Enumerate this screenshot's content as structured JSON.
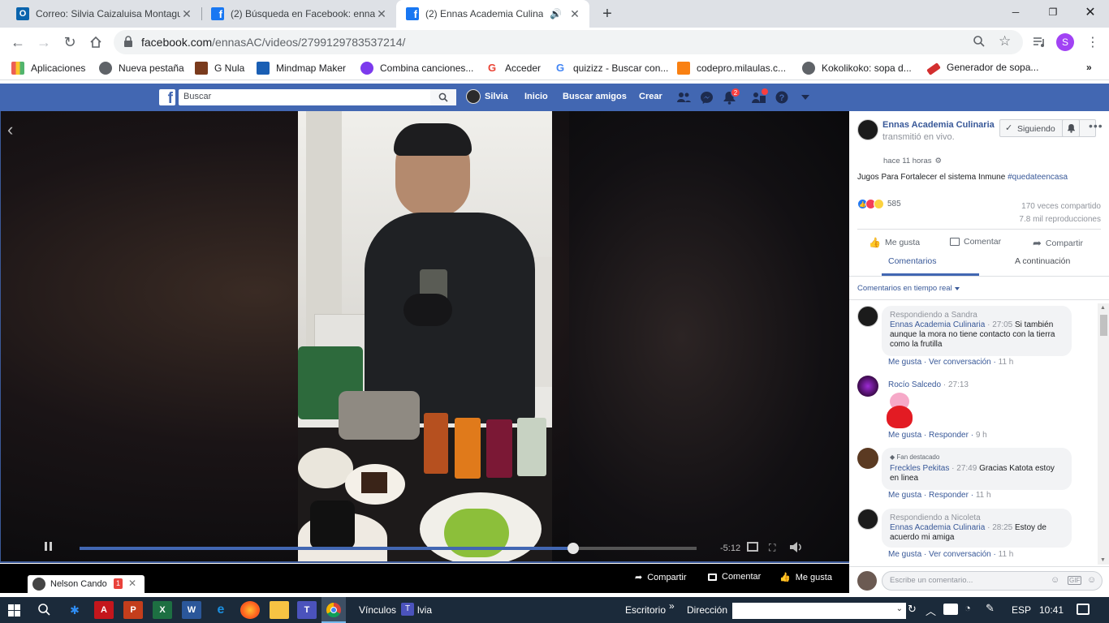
{
  "browser": {
    "tabs": [
      {
        "title": "Correo: Silvia Caizaluisa Montagu"
      },
      {
        "title": "(2) Búsqueda en Facebook: enna"
      },
      {
        "title": "(2) Ennas Academia Culinari"
      }
    ],
    "url_host": "facebook.com",
    "url_path": "/ennasAC/videos/2799129783537214/",
    "profile_initial": "S",
    "bookmarks": [
      "Aplicaciones",
      "Nueva pestaña",
      "G Nula",
      "Mindmap Maker",
      "Combina canciones...",
      "Acceder",
      "quizizz - Buscar con...",
      "codepro.milaulas.c...",
      "Kokolikoko: sopa d...",
      "Generador de sopa..."
    ]
  },
  "fb": {
    "search_placeholder": "Buscar",
    "user": "Silvia",
    "nav": [
      "Inicio",
      "Buscar amigos",
      "Crear"
    ],
    "notif_count": "2"
  },
  "video": {
    "time_remaining": "-5:12",
    "progress": 0.8,
    "actions": [
      "Compartir",
      "Comentar",
      "Me gusta"
    ]
  },
  "chat": {
    "name": "Nelson Cando",
    "badge": "1"
  },
  "post": {
    "page_name": "Ennas Academia Culinaria",
    "action": "transmitió en vivo.",
    "time": "hace 11 horas",
    "follow_label": "Siguiendo",
    "description": "Jugos Para Fortalecer el sistema Inmune",
    "hashtag": "#quedateencasa",
    "reaction_count": "585",
    "shares": "170 veces compartido",
    "views": "7.8 mil reproducciones",
    "actions": [
      "Me gusta",
      "Comentar",
      "Compartir"
    ],
    "tabs": [
      "Comentarios",
      "A continuación"
    ],
    "filter": "Comentarios en tiempo real",
    "comment_placeholder": "Escribe un comentario..."
  },
  "comments": [
    {
      "reply_to": "Respondiendo a Sandra",
      "author": "Ennas Academia Culinaria",
      "ts": "27:05",
      "text": "Si también aunque la mora no tiene contacto con la tierra como la frutilla",
      "links": [
        "Me gusta",
        "Ver conversación",
        "11 h"
      ]
    },
    {
      "author": "Rocío Salcedo",
      "ts": "27:13",
      "links": [
        "Me gusta",
        "Responder",
        "9 h"
      ]
    },
    {
      "badge": "Fan destacado",
      "author": "Freckles Pekitas",
      "ts": "27:49",
      "text": "Gracias Katota estoy en linea",
      "links": [
        "Me gusta",
        "Responder",
        "11 h"
      ]
    },
    {
      "reply_to": "Respondiendo a Nicoleta",
      "author": "Ennas Academia Culinaria",
      "ts": "28:25",
      "text": "Estoy de acuerdo mi amiga",
      "links": [
        "Me gusta",
        "Ver conversación",
        "11 h"
      ]
    }
  ],
  "taskbar": {
    "vinculos": "Vínculos",
    "lvia": "lvia",
    "escritorio": "Escritorio",
    "direccion": "Dirección",
    "lang": "ESP",
    "time": "10:41"
  },
  "colors": {
    "fb_blue": "#4267b2",
    "link": "#385898",
    "taskbar": "#1b2a3a"
  }
}
